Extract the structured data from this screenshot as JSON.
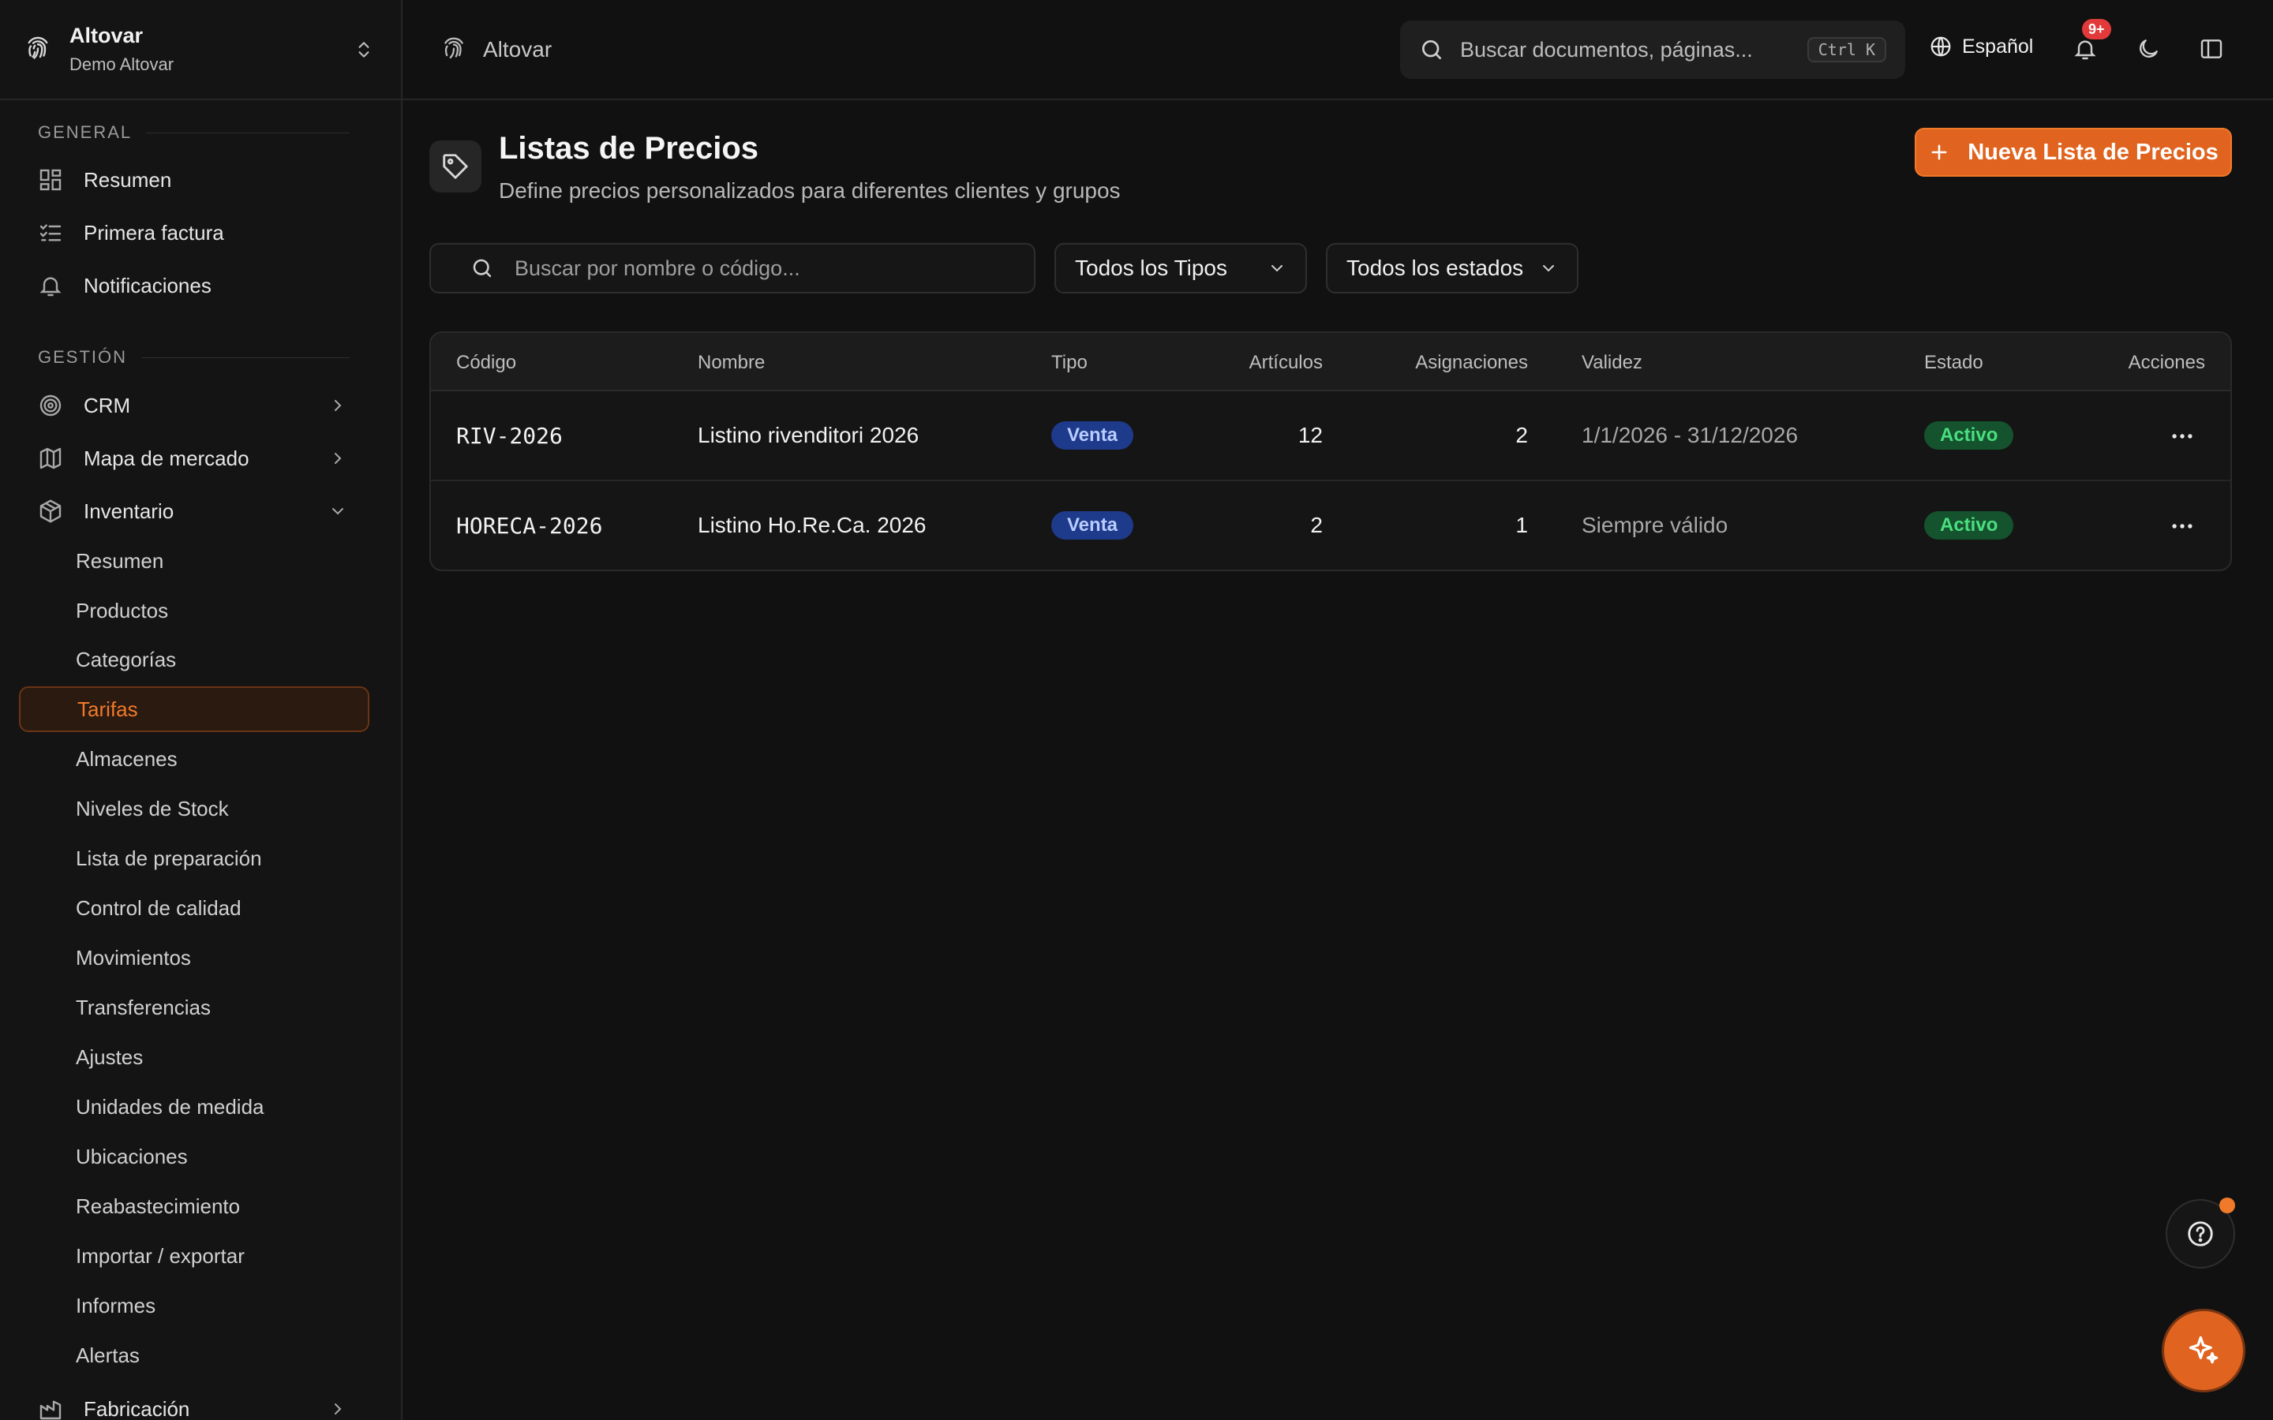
{
  "org": {
    "name": "Altovar",
    "subtitle": "Demo Altovar"
  },
  "sidebar": {
    "sections": [
      {
        "title": "GENERAL",
        "items": [
          {
            "label": "Resumen",
            "icon": "dashboard-icon"
          },
          {
            "label": "Primera factura",
            "icon": "checklist-icon"
          },
          {
            "label": "Notificaciones",
            "icon": "bell-icon"
          }
        ]
      },
      {
        "title": "GESTIÓN",
        "items": [
          {
            "label": "CRM",
            "icon": "target-icon",
            "expandable": true
          },
          {
            "label": "Mapa de mercado",
            "icon": "map-icon",
            "expandable": true
          },
          {
            "label": "Inventario",
            "icon": "box-icon",
            "expanded": true
          }
        ]
      }
    ],
    "inventory_sub": [
      "Resumen",
      "Productos",
      "Categorías",
      "Tarifas",
      "Almacenes",
      "Niveles de Stock",
      "Lista de preparación",
      "Control de calidad",
      "Movimientos",
      "Transferencias",
      "Ajustes",
      "Unidades de medida",
      "Ubicaciones",
      "Reabastecimiento",
      "Importar / exportar",
      "Informes",
      "Alertas"
    ],
    "active_sub": "Tarifas",
    "last_item": {
      "label": "Fabricación",
      "icon": "factory-icon"
    }
  },
  "topbar": {
    "breadcrumb": "Altovar",
    "search_placeholder": "Buscar documentos, páginas...",
    "shortcut": "Ctrl K",
    "language": "Español",
    "notifications_badge": "9+"
  },
  "page": {
    "title": "Listas de Precios",
    "subtitle": "Define precios personalizados para diferentes clientes y grupos",
    "new_button": "Nueva Lista de Precios",
    "search_placeholder": "Buscar por nombre o código...",
    "type_filter": "Todos los Tipos",
    "status_filter": "Todos los estados"
  },
  "table": {
    "headers": [
      "Código",
      "Nombre",
      "Tipo",
      "Artículos",
      "Asignaciones",
      "Validez",
      "Estado",
      "Acciones"
    ],
    "rows": [
      {
        "code": "RIV-2026",
        "name": "Listino rivenditori 2026",
        "type": "Venta",
        "items": "12",
        "assignments": "2",
        "validity": "1/1/2026 - 31/12/2026",
        "status": "Activo"
      },
      {
        "code": "HORECA-2026",
        "name": "Listino Ho.Re.Ca. 2026",
        "type": "Venta",
        "items": "2",
        "assignments": "1",
        "validity": "Siempre válido",
        "status": "Activo"
      }
    ]
  },
  "colors": {
    "accent": "#e0641f",
    "badge_blue": "#1e3a8a",
    "badge_green": "#14532d",
    "notif": "#e23a3a"
  }
}
